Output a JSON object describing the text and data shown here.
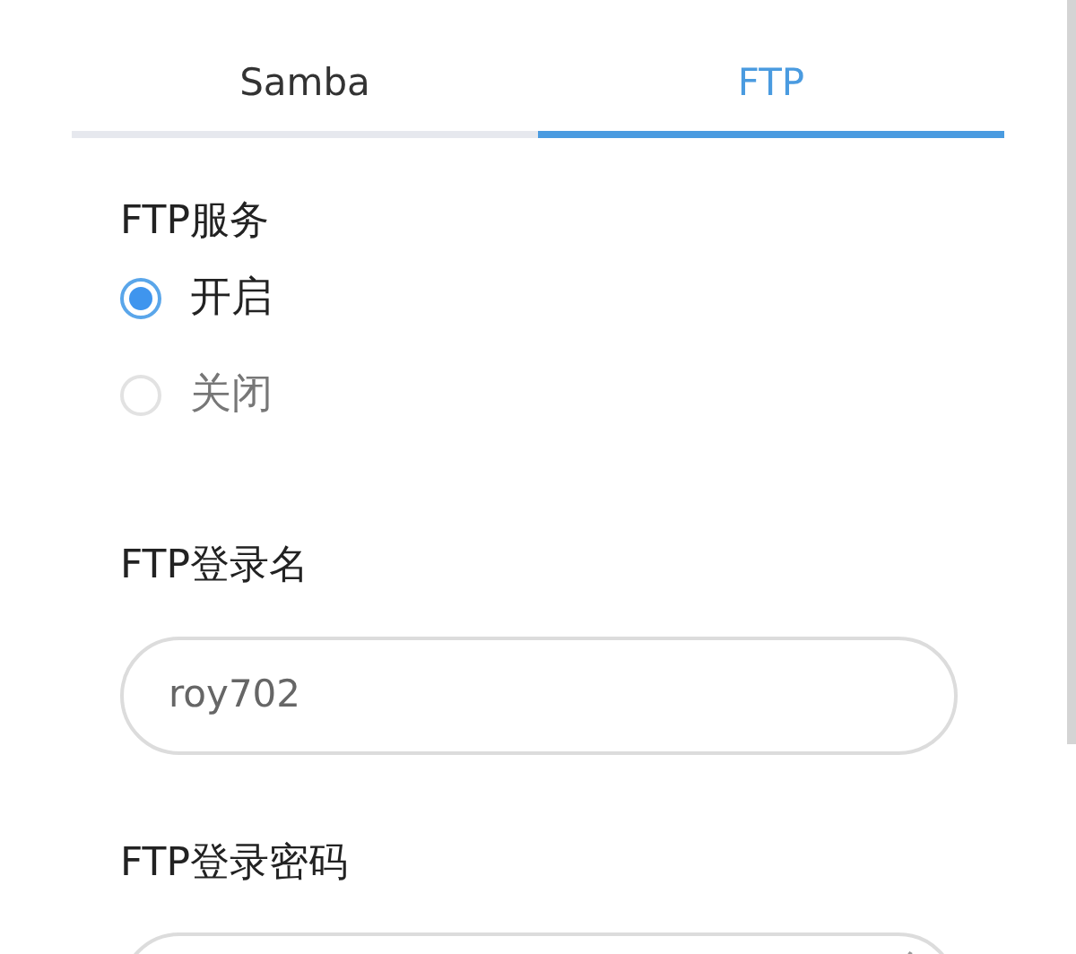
{
  "tabs": [
    {
      "label": "Samba",
      "selected": false
    },
    {
      "label": "FTP",
      "selected": true
    }
  ],
  "ftp_service": {
    "label": "FTP服务",
    "options": [
      {
        "label": "开启",
        "selected": true
      },
      {
        "label": "关闭",
        "selected": false
      }
    ]
  },
  "login_name": {
    "label": "FTP登录名",
    "value": "roy702"
  },
  "login_password": {
    "label": "FTP登录密码"
  }
}
